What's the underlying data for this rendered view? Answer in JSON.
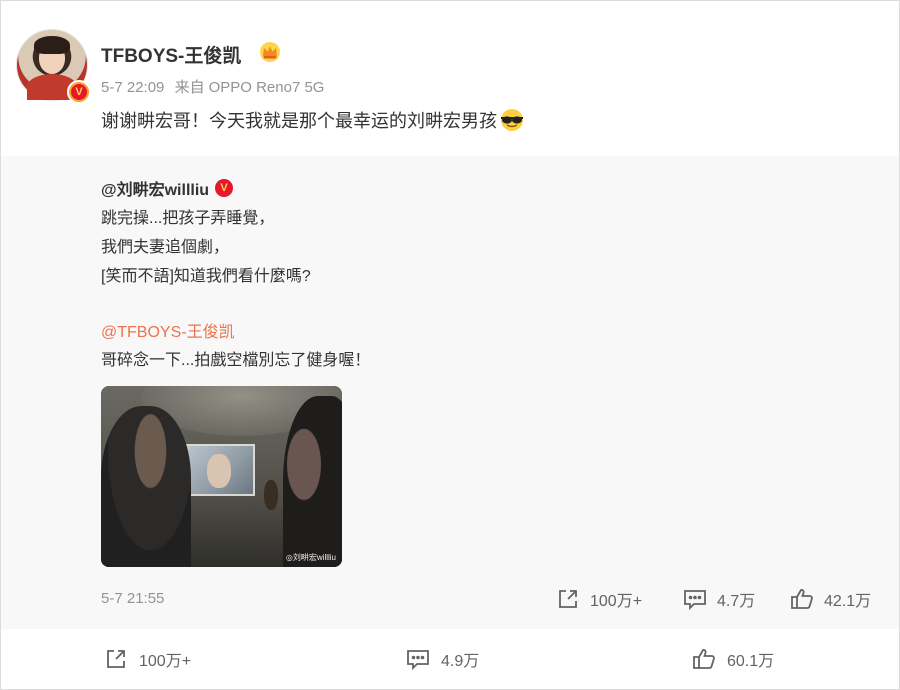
{
  "post": {
    "username": "TFBOYS-王俊凯",
    "time": "5-7 22:09",
    "source_prefix": "来自",
    "source_device": "OPPO Reno7 5G",
    "text": "谢谢畊宏哥！今天我就是那个最幸运的刘畊宏男孩",
    "icons": {
      "avatar": "avatar-image",
      "verified": "verified-v-badge",
      "crown": "crown-icon",
      "emoji": "sunglasses-emoji"
    }
  },
  "repost": {
    "author": "@刘畊宏willliu",
    "lines": [
      "跳完操...把孩子弄睡覺，",
      "我們夫妻追個劇，",
      "[笑而不語]知道我們看什麼嗎?"
    ],
    "mention": "@TFBOYS-王俊凯",
    "extra_line": "哥碎念一下...拍戲空檔別忘了健身喔！",
    "photo_watermark": "◎刘畊宏willliu",
    "time": "5-7 21:55",
    "stats": {
      "reposts": "100万+",
      "comments": "4.7万",
      "likes": "42.1万"
    }
  },
  "footer": {
    "reposts": "100万+",
    "comments": "4.9万",
    "likes": "60.1万"
  },
  "colors": {
    "mention": "#eb7350",
    "verified_gold": "#f5a623",
    "verified_red": "#e6162d",
    "meta_gray": "#939393",
    "repost_bg": "#f8f8f8"
  }
}
